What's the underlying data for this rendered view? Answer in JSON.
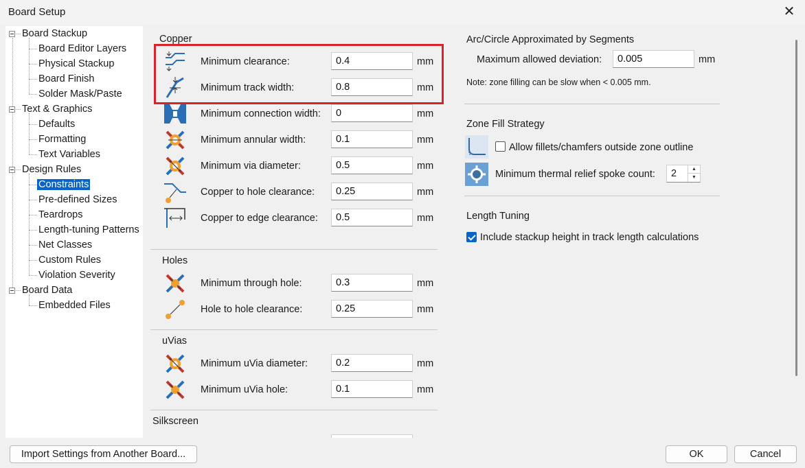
{
  "window": {
    "title": "Board Setup"
  },
  "tree": [
    {
      "label": "Board Stackup",
      "level": 0
    },
    {
      "label": "Board Editor Layers",
      "level": 1
    },
    {
      "label": "Physical Stackup",
      "level": 1
    },
    {
      "label": "Board Finish",
      "level": 1
    },
    {
      "label": "Solder Mask/Paste",
      "level": 1
    },
    {
      "label": "Text & Graphics",
      "level": 0
    },
    {
      "label": "Defaults",
      "level": 1
    },
    {
      "label": "Formatting",
      "level": 1
    },
    {
      "label": "Text Variables",
      "level": 1
    },
    {
      "label": "Design Rules",
      "level": 0
    },
    {
      "label": "Constraints",
      "level": 1,
      "selected": true
    },
    {
      "label": "Pre-defined Sizes",
      "level": 1
    },
    {
      "label": "Teardrops",
      "level": 1
    },
    {
      "label": "Length-tuning Patterns",
      "level": 1
    },
    {
      "label": "Net Classes",
      "level": 1
    },
    {
      "label": "Custom Rules",
      "level": 1
    },
    {
      "label": "Violation Severity",
      "level": 1
    },
    {
      "label": "Board Data",
      "level": 0
    },
    {
      "label": "Embedded Files",
      "level": 1
    }
  ],
  "copper": {
    "title": "Copper",
    "rows": [
      {
        "label": "Minimum clearance:",
        "value": "0.4",
        "unit": "mm",
        "icon": "clearance-icon"
      },
      {
        "label": "Minimum track width:",
        "value": "0.8",
        "unit": "mm",
        "icon": "track-width-icon"
      },
      {
        "label": "Minimum connection width:",
        "value": "0",
        "unit": "mm",
        "icon": "connection-width-icon"
      },
      {
        "label": "Minimum annular width:",
        "value": "0.1",
        "unit": "mm",
        "icon": "annular-width-icon"
      },
      {
        "label": "Minimum via diameter:",
        "value": "0.5",
        "unit": "mm",
        "icon": "via-diameter-icon"
      },
      {
        "label": "Copper to hole clearance:",
        "value": "0.25",
        "unit": "mm",
        "icon": "hole-clearance-icon"
      },
      {
        "label": "Copper to edge clearance:",
        "value": "0.5",
        "unit": "mm",
        "icon": "edge-clearance-icon"
      }
    ]
  },
  "holes": {
    "title": "Holes",
    "rows": [
      {
        "label": "Minimum through hole:",
        "value": "0.3",
        "unit": "mm",
        "icon": "through-hole-icon"
      },
      {
        "label": "Hole to hole clearance:",
        "value": "0.25",
        "unit": "mm",
        "icon": "hole-to-hole-icon"
      }
    ]
  },
  "uvias": {
    "title": "uVias",
    "rows": [
      {
        "label": "Minimum uVia diameter:",
        "value": "0.2",
        "unit": "mm",
        "icon": "uvia-diameter-icon"
      },
      {
        "label": "Minimum uVia hole:",
        "value": "0.1",
        "unit": "mm",
        "icon": "uvia-hole-icon"
      }
    ]
  },
  "silkscreen": {
    "title": "Silkscreen"
  },
  "arc": {
    "title": "Arc/Circle Approximated by Segments",
    "label": "Maximum allowed deviation:",
    "value": "0.005",
    "unit": "mm",
    "note": "Note: zone filling can be slow when < 0.005 mm."
  },
  "zone": {
    "title": "Zone Fill Strategy",
    "fillets_label": "Allow fillets/chamfers outside zone outline",
    "fillets_checked": false,
    "spoke_label": "Minimum thermal relief spoke count:",
    "spoke_value": "2"
  },
  "length": {
    "title": "Length Tuning",
    "stackup_label": "Include stackup height in track length calculations",
    "stackup_checked": true
  },
  "footer": {
    "import_label": "Import Settings from Another Board...",
    "ok_label": "OK",
    "cancel_label": "Cancel"
  },
  "colors": {
    "highlight": "#d9232a",
    "selection": "#0a64c8"
  }
}
